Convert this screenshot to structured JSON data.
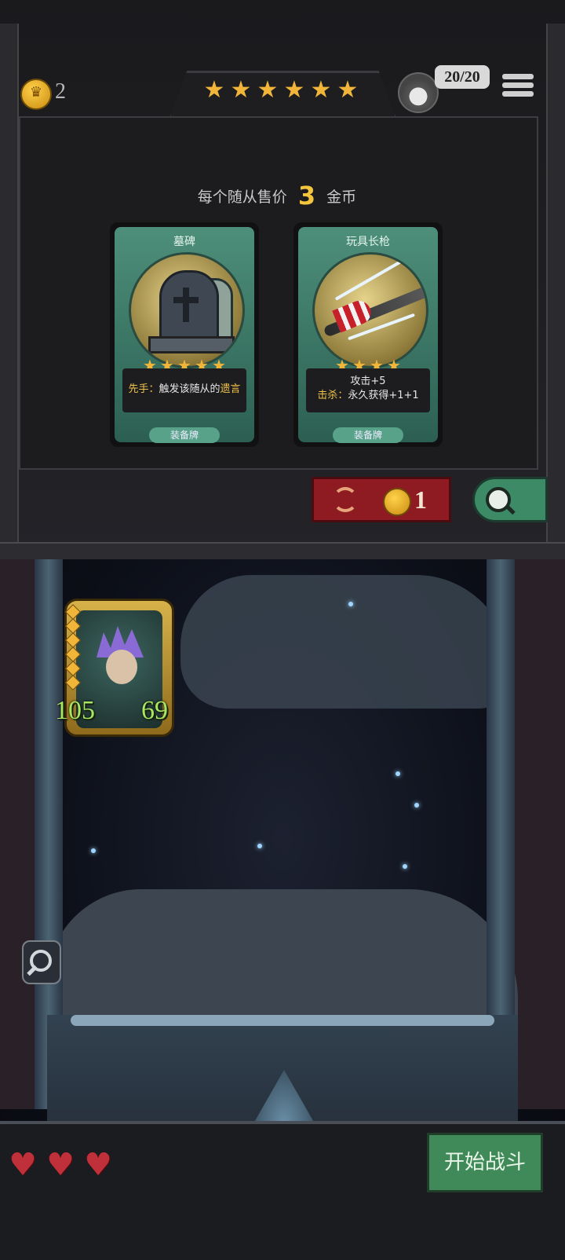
{
  "header": {
    "coins": "2",
    "tier_stars": 6,
    "player_hp": "20/20"
  },
  "shop": {
    "sell_prefix": "每个随从售价",
    "sell_price": "3",
    "sell_suffix": "金币",
    "cards": [
      {
        "title": "墓碑",
        "stars": 5,
        "desc_keyword": "先手：",
        "desc_text": "触发该随从的",
        "desc_keyword2": "遗言",
        "tag": "装备牌"
      },
      {
        "title": "玩具长枪",
        "stars": 4,
        "desc_line1": "攻击+5",
        "desc_keyword": "击杀：",
        "desc_line2": "永久获得+1+1",
        "tag": "装备牌"
      }
    ],
    "reroll_cost": "1"
  },
  "board": {
    "minion": {
      "attack": "105",
      "health": "69",
      "pips": 6
    }
  },
  "footer": {
    "lives": 3,
    "start_label": "开始战斗"
  }
}
